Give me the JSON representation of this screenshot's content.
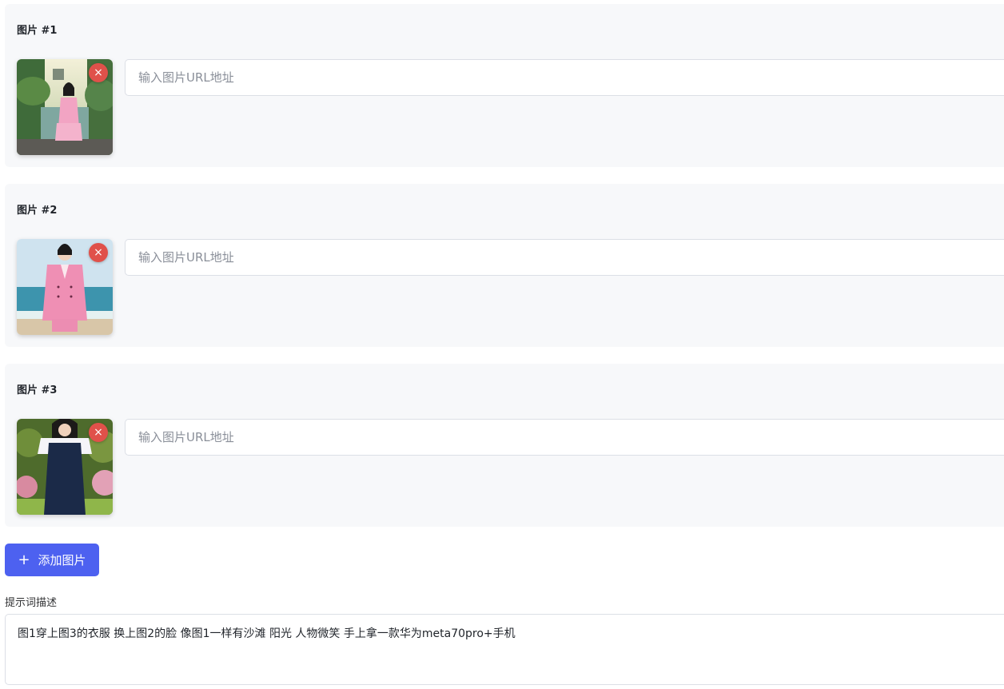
{
  "images": [
    {
      "title": "图片 #1",
      "remove_label": "×",
      "url_value": "",
      "url_placeholder": "输入图片URL地址",
      "thumbnail": "woman-pink-dress-waterfall-photo"
    },
    {
      "title": "图片 #2",
      "remove_label": "×",
      "url_value": "",
      "url_placeholder": "输入图片URL地址",
      "thumbnail": "woman-pink-blazer-beach-photo"
    },
    {
      "title": "图片 #3",
      "remove_label": "×",
      "url_value": "",
      "url_placeholder": "输入图片URL地址",
      "thumbnail": "woman-navy-pinafore-garden-photo"
    }
  ],
  "add_button": {
    "icon": "plus-icon",
    "label": "添加图片"
  },
  "prompt": {
    "label": "提示词描述",
    "value": "图1穿上图3的衣服 换上图2的脸 像图1一样有沙滩 阳光 人物微笑 手上拿一款华为meta70pro+手机"
  },
  "colors": {
    "accent": "#4d61f0",
    "remove": "#e0514a",
    "card_bg": "#f7f8fa",
    "border": "#dcdfe6"
  }
}
